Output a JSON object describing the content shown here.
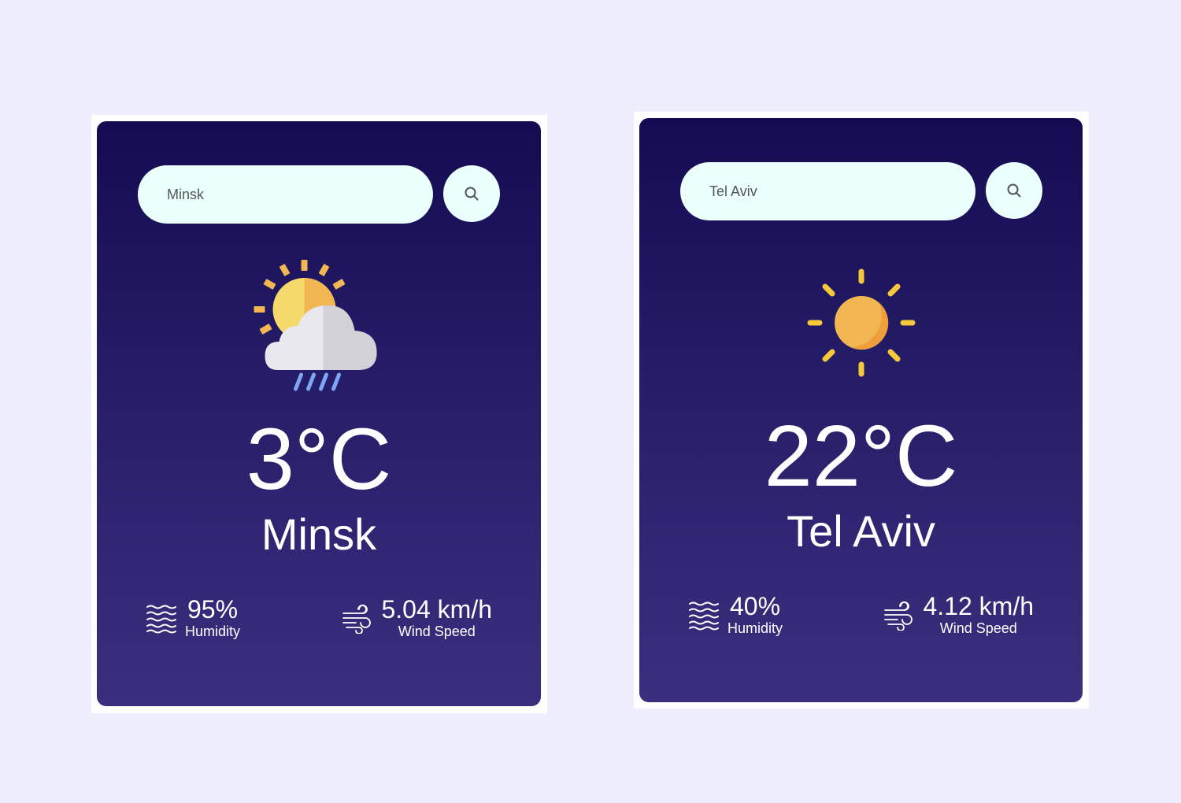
{
  "cards": [
    {
      "search_value": "Minsk",
      "condition_icon": "sun-cloud-rain-icon",
      "temperature": "3°C",
      "city": "Minsk",
      "humidity": {
        "value": "95%",
        "label": "Humidity"
      },
      "wind": {
        "value": "5.04 km/h",
        "label": "Wind Speed"
      }
    },
    {
      "search_value": "Tel Aviv",
      "condition_icon": "sun-icon",
      "temperature": "22°C",
      "city": "Tel Aviv",
      "humidity": {
        "value": "40%",
        "label": "Humidity"
      },
      "wind": {
        "value": "4.12 km/h",
        "label": "Wind Speed"
      }
    }
  ],
  "colors": {
    "page_background": "#efeefe",
    "card_gradient_top": "#140b52",
    "card_gradient_bottom": "#3a2f7e",
    "search_background": "#ebfffc",
    "sun": "#f2b652",
    "sun_rays": "#f6c93b"
  }
}
